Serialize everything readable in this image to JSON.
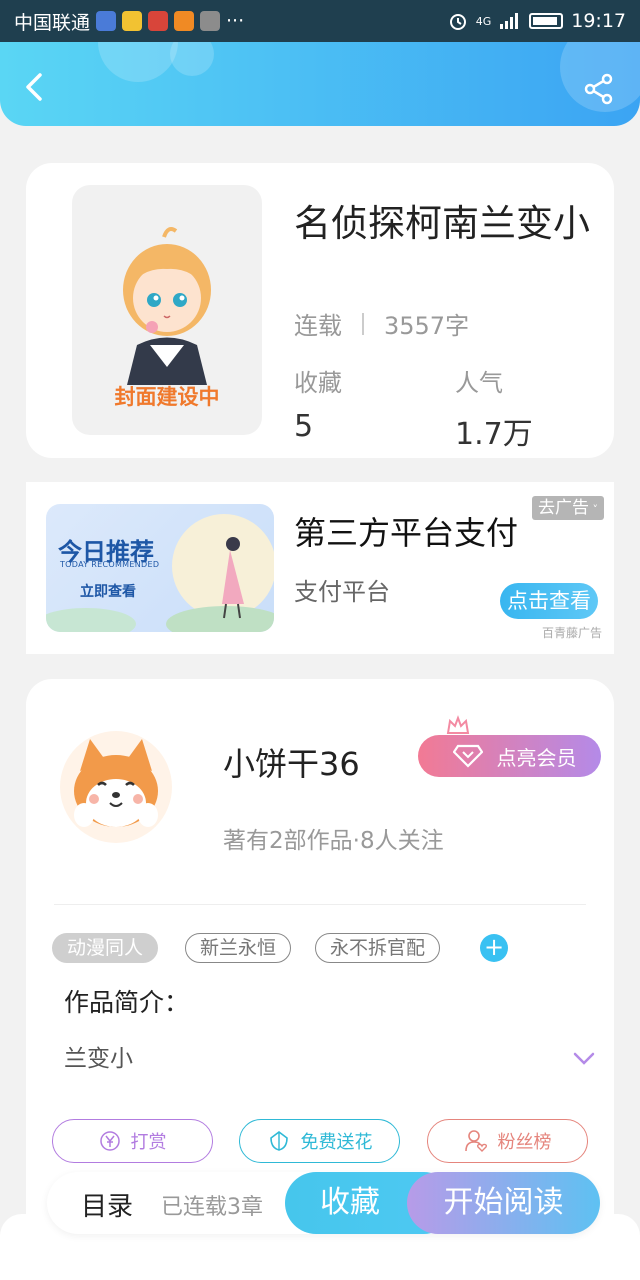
{
  "status_bar": {
    "carrier": "中国联通",
    "more": "···",
    "network": "4G",
    "time": "19:17"
  },
  "book": {
    "title": "名侦探柯南兰变小",
    "status": "连载",
    "words": "3557字",
    "cover_text": "封面建设中",
    "stats": [
      {
        "label": "收藏",
        "value": "5"
      },
      {
        "label": "人气",
        "value": "1.7万"
      }
    ]
  },
  "ad": {
    "banner_title": "今日推荐",
    "banner_sub": "TODAY RECOMMENDED",
    "banner_button": "立即查看",
    "title": "第三方平台支付",
    "subtitle": "支付平台",
    "remove_label": "去广告",
    "cta": "点击查看",
    "source": "百青藤广告"
  },
  "author": {
    "name": "小饼干36",
    "vip_button": "点亮会员",
    "summary": "著有2部作品·8人关注"
  },
  "tags": [
    "动漫同人",
    "新兰永恒",
    "永不拆官配"
  ],
  "intro": {
    "label": "作品简介：",
    "text": "兰变小"
  },
  "actions": [
    {
      "label": "打赏",
      "color": "#b27ce0"
    },
    {
      "label": "免费送花",
      "color": "#2fb9d6"
    },
    {
      "label": "粉丝榜",
      "color": "#e5857d"
    }
  ],
  "bottom_bar": {
    "toc": "目录",
    "serial": "已连载3章",
    "favorite": "收藏",
    "read": "开始阅读"
  },
  "colors": {
    "header_start": "#5ad6f4",
    "header_end": "#3ba4f3",
    "accent_blue": "#39c1f2",
    "cover_text": "#f0792c"
  }
}
